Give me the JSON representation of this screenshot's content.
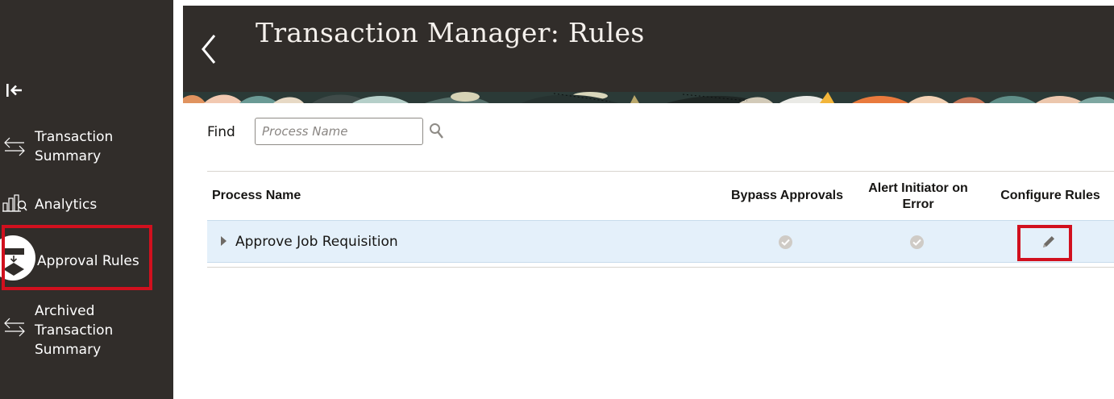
{
  "sidebar": {
    "items": [
      {
        "label_lines": [
          "Transaction",
          "Summary"
        ],
        "icon": "swap-arrows-icon"
      },
      {
        "label": "Analytics",
        "icon": "analytics-chart-icon"
      },
      {
        "label": "Approval Rules",
        "icon": "approval-rules-icon",
        "active": true
      },
      {
        "label_lines": [
          "Archived",
          "Transaction",
          "Summary"
        ],
        "icon": "swap-arrows-icon"
      }
    ]
  },
  "header": {
    "title": "Transaction Manager: Rules"
  },
  "search": {
    "label": "Find",
    "placeholder": "Process Name"
  },
  "table": {
    "columns": [
      "Process Name",
      "Bypass Approvals",
      "Alert Initiator on Error",
      "Configure Rules"
    ],
    "rows": [
      {
        "process_name": "Approve Job Requisition",
        "bypass_approvals": true,
        "alert_initiator_on_error": true
      }
    ]
  },
  "colors": {
    "sidebar_bg": "#312d2a",
    "header_bg": "#312d2a",
    "selected_row_bg": "#e4f0fa",
    "highlight_red": "#d1101e"
  }
}
